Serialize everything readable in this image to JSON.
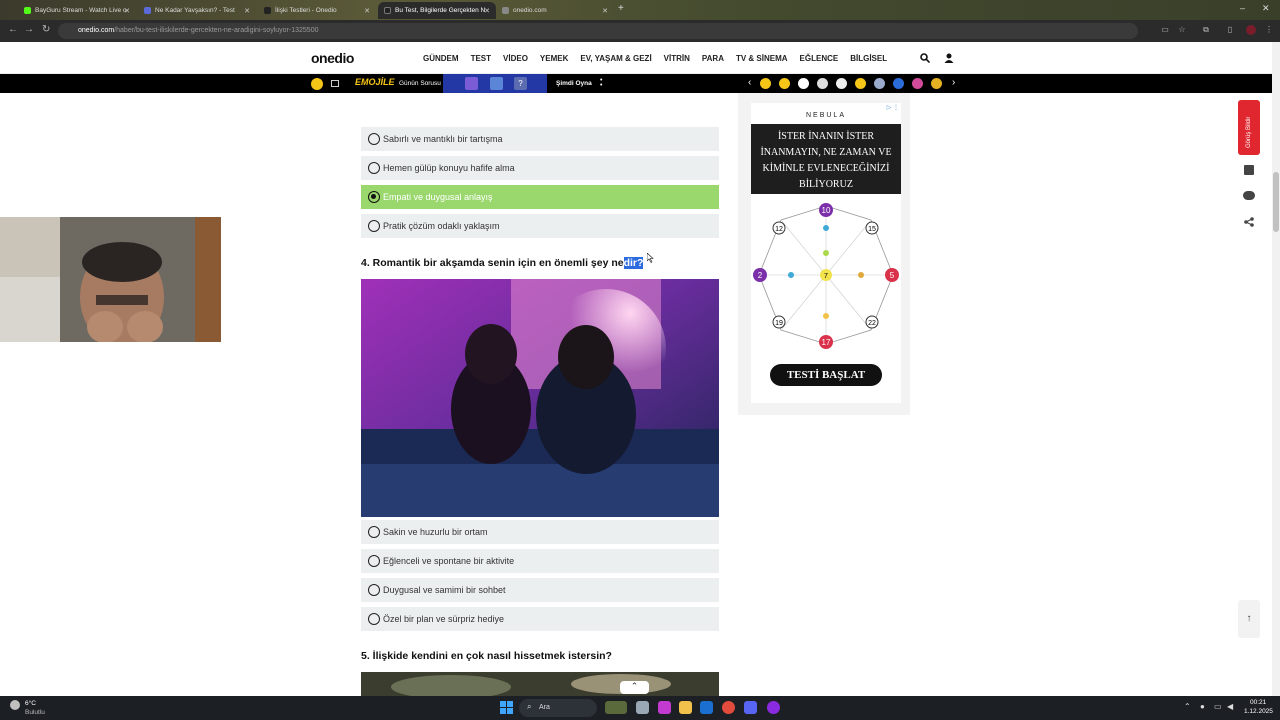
{
  "tabs": [
    {
      "title": "BayGuru Stream - Watch Live o",
      "active": false,
      "color": "#53fc18"
    },
    {
      "title": "Ne Kadar Yavşaksın? - Test",
      "active": false,
      "color": "#5a6bd8"
    },
    {
      "title": "İlişki Testleri - Onedio",
      "active": false,
      "color": "#222222"
    },
    {
      "title": "Bu Test, Bilgilerde Gerçekten N",
      "active": true,
      "color": "#222222"
    },
    {
      "title": "onedio.com",
      "active": false,
      "color": "#888888"
    }
  ],
  "address": {
    "host": "onedio.com",
    "path": "/haber/bu-test-iliskilerde-gercekten-ne-aradigini-soyluyor-1325500"
  },
  "site": {
    "logo": "onedio",
    "menu": [
      "GÜNDEM",
      "TEST",
      "VİDEO",
      "YEMEK",
      "EV, YAŞAM & GEZİ",
      "VİTRİN",
      "PARA",
      "TV & SİNEMA",
      "EĞLENCE",
      "BİLGİSEL"
    ]
  },
  "subbar": {
    "emojile": "EMOJİLE",
    "gunun_sorusu": "Günün Sorusu",
    "simdi_oyna": "Şimdi Oyna",
    "q_mark": "?"
  },
  "question3_options": [
    {
      "text": "Sabırlı ve mantıklı bir tartışma",
      "selected": false
    },
    {
      "text": "Hemen gülüp konuyu hafife alma",
      "selected": false
    },
    {
      "text": "Empati ve duygusal anlayış",
      "selected": true
    },
    {
      "text": "Pratik çözüm odaklı yaklaşım",
      "selected": false
    }
  ],
  "question4": {
    "title_prefix": "4. Romantik bir akşamda senin için en önemli şey ne",
    "title_highlight": "dir?",
    "options": [
      {
        "text": "Sakin ve huzurlu bir ortam"
      },
      {
        "text": "Eğlenceli ve spontane bir aktivite"
      },
      {
        "text": "Duygusal ve samimi bir sohbet"
      },
      {
        "text": "Özel bir plan ve sürpriz hediye"
      }
    ]
  },
  "question5": {
    "title": "5. İlişkide kendini en çok nasıl hissetmek istersin?"
  },
  "ad": {
    "brand": "NEBULA",
    "headline": "İSTER İNANIN İSTER İNANMAYIN, NE ZAMAN VE KİMİNLE EVLENECEĞİNİZİ BİLİYORUZ",
    "cta": "TESTİ BAŞLAT",
    "numbers": [
      "10",
      "15",
      "5",
      "22",
      "17",
      "19",
      "2",
      "12",
      "7"
    ]
  },
  "side": {
    "feedback": "Görüş Bildir"
  },
  "taskbar": {
    "weather_temp": "6°C",
    "weather_desc": "Bulutlu",
    "search": "Ara",
    "time": "00:21",
    "date": "1.12.2025"
  },
  "colors": {
    "selected_option": "#9ad86e",
    "option_bg": "#ebeff0",
    "feedback": "#e0262f"
  }
}
